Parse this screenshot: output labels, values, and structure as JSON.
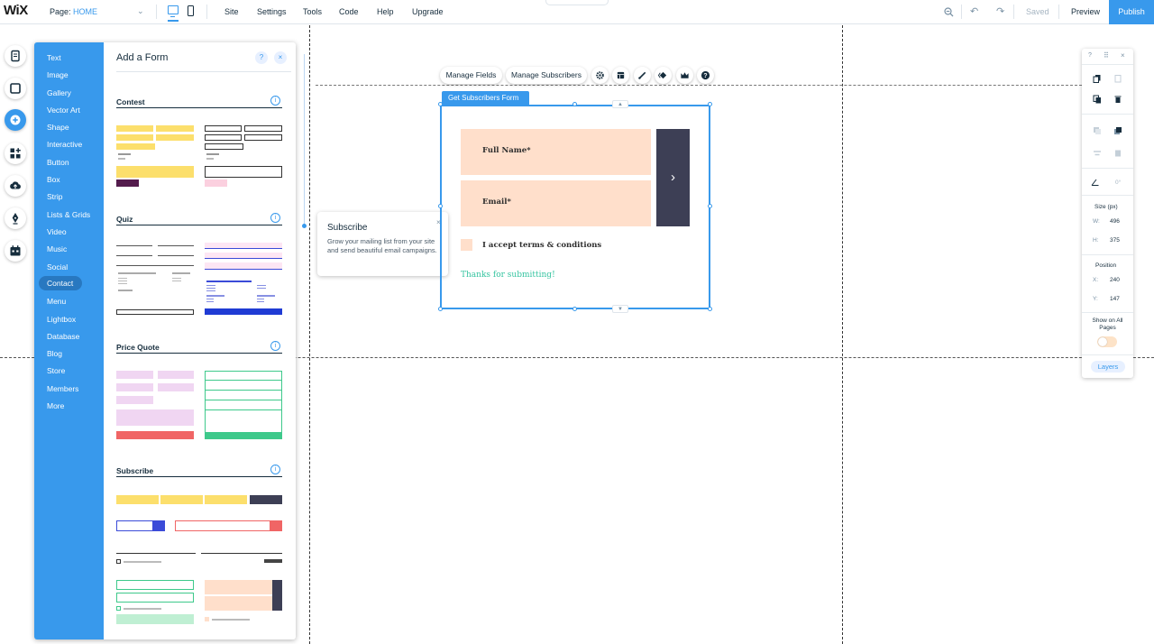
{
  "topbar": {
    "logo": "WiX",
    "page_label": "Page:",
    "page_name": "HOME",
    "menus": [
      "Site",
      "Settings",
      "Tools",
      "Code",
      "Help",
      "Upgrade"
    ],
    "saved": "Saved",
    "preview": "Preview",
    "publish": "Publish"
  },
  "add_panel": {
    "title": "Add a Form",
    "help": "?",
    "close": "×",
    "categories": [
      "Text",
      "Image",
      "Gallery",
      "Vector Art",
      "Shape",
      "Interactive",
      "Button",
      "Box",
      "Strip",
      "Lists & Grids",
      "Video",
      "Music",
      "Social",
      "Contact",
      "Menu",
      "Lightbox",
      "Database",
      "Blog",
      "Store",
      "Members",
      "More"
    ],
    "selected_category": "Contact",
    "sections": [
      "Contest",
      "Quiz",
      "Price Quote",
      "Subscribe"
    ],
    "info": "i"
  },
  "form": {
    "toolbar": [
      "Manage Fields",
      "Manage Subscribers"
    ],
    "tag": "Get Subscribers Form",
    "fields": [
      "Full Name*",
      "Email*"
    ],
    "submit": "›",
    "terms": "I accept terms & conditions",
    "thanks": "Thanks for submitting!"
  },
  "tooltip": {
    "title": "Subscribe",
    "body": "Grow your mailing list from your site and send beautiful email campaigns.",
    "close": "×"
  },
  "right_panel": {
    "help": "?",
    "drag": "⠿",
    "close": "×",
    "angle": "0°",
    "size_label": "Size (px)",
    "w_label": "W:",
    "w_value": "496",
    "h_label": "H:",
    "h_value": "375",
    "position_label": "Position",
    "x_label": "X:",
    "x_value": "240",
    "y_label": "Y:",
    "y_value": "147",
    "show_all_pages": "Show on All Pages",
    "layers": "Layers"
  },
  "colors": {
    "accent": "#3899ec",
    "field": "#ffdfcb",
    "submit": "#3d3f55",
    "thanks": "#35c4a0"
  }
}
